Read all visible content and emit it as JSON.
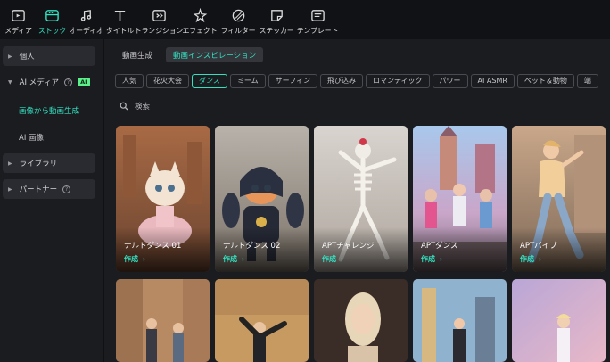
{
  "toolbar": {
    "items": [
      {
        "label": "メディア",
        "icon": "media-icon"
      },
      {
        "label": "ストック",
        "icon": "stock-icon",
        "active": true
      },
      {
        "label": "オーディオ",
        "icon": "music-note-icon"
      },
      {
        "label": "タイトル",
        "icon": "title-t-icon"
      },
      {
        "label": "トランジション",
        "icon": "transition-icon"
      },
      {
        "label": "エフェクト",
        "icon": "sparkle-icon"
      },
      {
        "label": "フィルター",
        "icon": "filter-icon"
      },
      {
        "label": "ステッカー",
        "icon": "sticker-icon"
      },
      {
        "label": "テンプレート",
        "icon": "template-icon"
      }
    ]
  },
  "sidebar": {
    "personal": "個人",
    "ai_media": "AI メディア",
    "ai_badge": "AI",
    "sub_items": [
      "画像から動画生成",
      "AI 画像"
    ],
    "library": "ライブラリ",
    "partner": "パートナー"
  },
  "main": {
    "tabs": [
      "動画生成",
      "動画インスピレーション"
    ],
    "tags": [
      "人気",
      "花火大会",
      "ダンス",
      "ミーム",
      "サーフィン",
      "飛び込み",
      "ロマンティック",
      "パワー",
      "AI ASMR",
      "ペット＆動物",
      "端"
    ],
    "search_placeholder": "検索",
    "cta_label": "作成",
    "cta_arrow": "›",
    "cards": [
      {
        "title": "ナルトダンス 01"
      },
      {
        "title": "ナルトダンス 02"
      },
      {
        "title": "APTチャレンジ"
      },
      {
        "title": "APTダンス"
      },
      {
        "title": "APTバイブ"
      }
    ]
  },
  "colors": {
    "accent": "#33e0c0",
    "background": "#1b1c20",
    "toolbar_bg": "#111215",
    "sidebar_item_bg": "#2a2b30",
    "ai_badge": "#5cf08a"
  }
}
